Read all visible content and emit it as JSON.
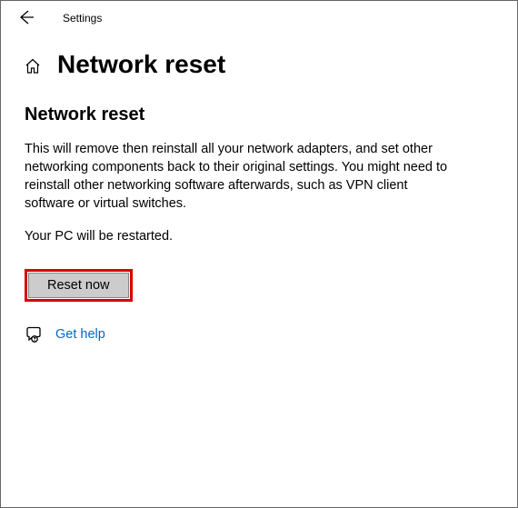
{
  "titlebar": {
    "app_name": "Settings"
  },
  "header": {
    "title": "Network reset"
  },
  "content": {
    "heading": "Network reset",
    "description": "This will remove then reinstall all your network adapters, and set other networking components back to their original settings. You might need to reinstall other networking software afterwards, such as VPN client software or virtual switches.",
    "restart_notice": "Your PC will be restarted.",
    "reset_button_label": "Reset now"
  },
  "help": {
    "link_text": "Get help"
  },
  "icons": {
    "back": "back-arrow-icon",
    "home": "home-icon",
    "help": "get-help-icon"
  }
}
